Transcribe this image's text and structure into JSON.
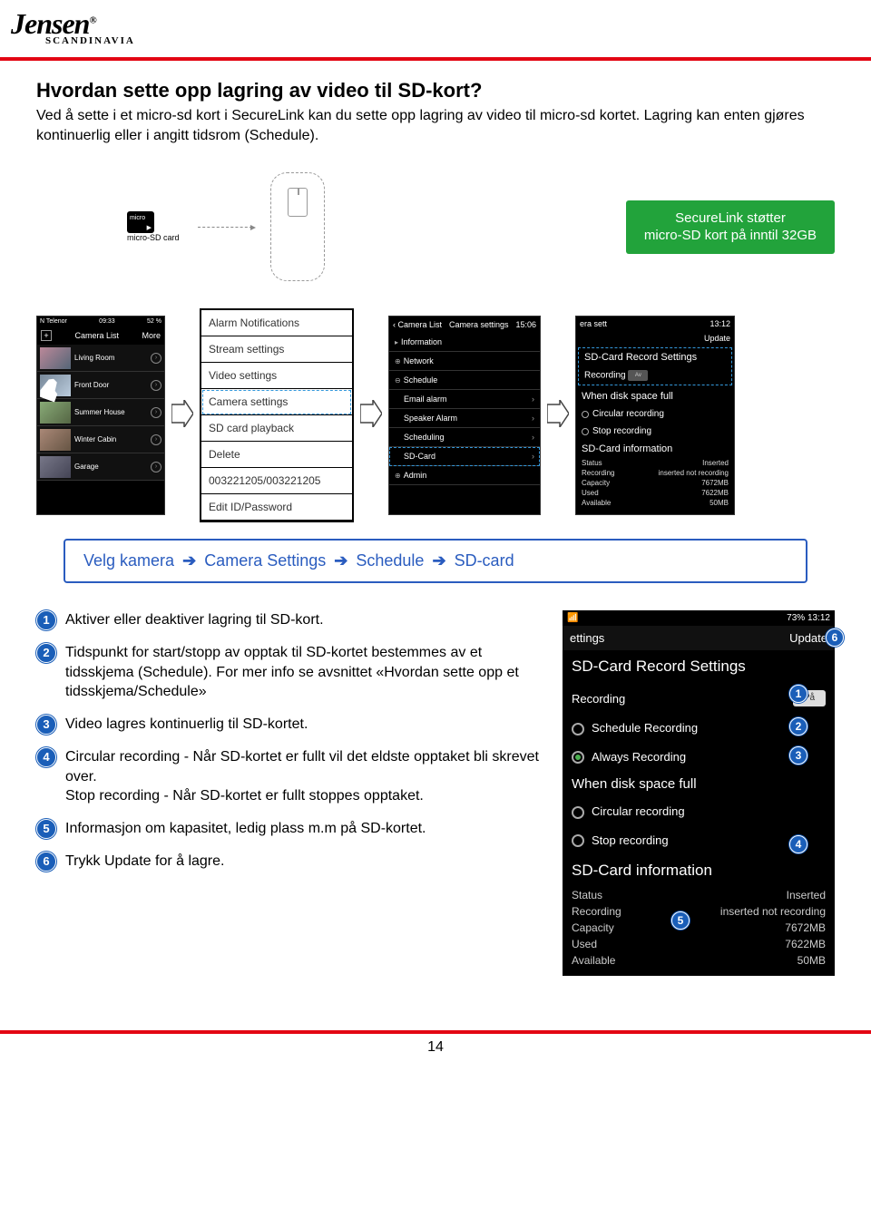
{
  "logo": {
    "brand": "Jensen",
    "sub": "SCANDINAVIA"
  },
  "title": "Hvordan sette opp lagring av video til SD-kort?",
  "intro": "Ved å sette i et micro-sd kort i SecureLink kan du sette opp lagring av video til micro-sd kortet. Lagring kan enten gjøres kontinuerlig eller i angitt tidsrom (Schedule).",
  "sd_label": "micro-SD card",
  "green_badge_line1": "SecureLink støtter",
  "green_badge_line2": "micro-SD kort på inntil 32GB",
  "screen1": {
    "status_left": "N Telenor",
    "status_time": "09:33",
    "status_right": "52 %",
    "header": "Camera List",
    "more": "More",
    "rows": [
      "Living Room",
      "Front Door",
      "Summer House",
      "Winter Cabin",
      "Garage"
    ]
  },
  "settings_list": [
    "Alarm Notifications",
    "Stream settings",
    "Video settings",
    "Camera settings",
    "SD card playback",
    "Delete",
    "003221205/003221205",
    "Edit ID/Password"
  ],
  "screen3": {
    "title": "Camera settings",
    "time": "15:06",
    "rows": [
      "Information",
      "Network",
      "Schedule",
      "Email alarm",
      "Speaker Alarm",
      "Scheduling",
      "SD-Card",
      "Admin"
    ]
  },
  "screen4": {
    "time": "13:12",
    "back": "era sett",
    "update": "Update",
    "title": "SD-Card Record Settings",
    "recording": "Recording",
    "toggle": "Av",
    "disk_title": "When disk space full",
    "opt1": "Circular recording",
    "opt2": "Stop recording",
    "info_title": "SD-Card information",
    "info": {
      "Status": "Inserted",
      "Recording": "inserted not recording",
      "Capacity": "7672MB",
      "Used": "7622MB",
      "Available": "50MB"
    }
  },
  "banner": {
    "prefix": "Velg kamera",
    "p1": "Camera Settings",
    "p2": "Schedule",
    "p3": "SD-card"
  },
  "steps": [
    "Aktiver eller deaktiver lagring til SD-kort.",
    "Tidspunkt for start/stopp av opptak til SD-kortet bestemmes av et tidsskjema (Schedule). For mer info se avsnittet «Hvordan sette opp et tidsskjema/Schedule»",
    "Video lagres kontinuerlig til SD-kortet.",
    "Circular recording - Når SD-kortet er fullt vil det eldste opptaket bli skrevet over.\nStop recording - Når SD-kortet er fullt stoppes opptaket.",
    "Informasjon om kapasitet, ledig plass m.m på SD-kortet.",
    "Trykk Update for å lagre."
  ],
  "phone": {
    "status_right": "73%",
    "time": "13:12",
    "back": "ettings",
    "update": "Update",
    "title": "SD-Card Record Settings",
    "recording_label": "Recording",
    "recording_toggle": "På",
    "sched": "Schedule Recording",
    "always": "Always Recording",
    "disk_title": "When disk space full",
    "circ": "Circular recording",
    "stop": "Stop recording",
    "info_title": "SD-Card information",
    "info_rows": [
      [
        "Status",
        "Inserted"
      ],
      [
        "Recording",
        "inserted not recording"
      ],
      [
        "Capacity",
        "7672MB"
      ],
      [
        "Used",
        "7622MB"
      ],
      [
        "Available",
        "50MB"
      ]
    ]
  },
  "page_number": "14"
}
